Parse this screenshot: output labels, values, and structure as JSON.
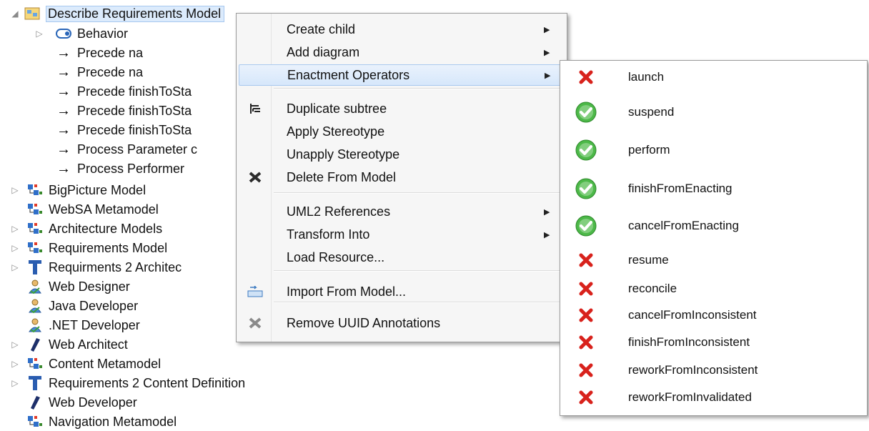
{
  "tree": {
    "root": {
      "label": "Describe Requirements Model"
    },
    "children": [
      {
        "label": "Behavior",
        "icon": "behavior-icon"
      },
      {
        "label": "Precede na",
        "icon": "arrow-icon"
      },
      {
        "label": "Precede na",
        "icon": "arrow-icon"
      },
      {
        "label": "Precede finishToSta",
        "icon": "arrow-icon"
      },
      {
        "label": "Precede finishToSta",
        "icon": "arrow-icon"
      },
      {
        "label": "Precede finishToSta",
        "icon": "arrow-icon"
      },
      {
        "label": "Process Parameter c",
        "icon": "arrow-icon"
      },
      {
        "label": "Process Performer",
        "icon": "arrow-icon"
      }
    ],
    "items": [
      {
        "label": "BigPicture Model",
        "icon": "model-icon",
        "expandable": true
      },
      {
        "label": "WebSA Metamodel",
        "icon": "model-icon",
        "expandable": false
      },
      {
        "label": "Architecture Models",
        "icon": "model-icon",
        "expandable": true
      },
      {
        "label": "Requirements Model",
        "icon": "model-icon",
        "expandable": true
      },
      {
        "label": "Requirments  2 Architec",
        "icon": "transform-icon",
        "expandable": true
      },
      {
        "label": "Web Designer",
        "icon": "role-icon",
        "expandable": false
      },
      {
        "label": "Java Developer",
        "icon": "role-icon",
        "expandable": false
      },
      {
        "label": ".NET  Developer",
        "icon": "role-icon",
        "expandable": false
      },
      {
        "label": "Web Architect",
        "icon": "tool-icon",
        "expandable": true
      },
      {
        "label": "Content Metamodel",
        "icon": "model-icon",
        "expandable": true
      },
      {
        "label": "Requirements 2 Content Definition",
        "icon": "transform-icon",
        "expandable": true
      },
      {
        "label": "Web Developer",
        "icon": "tool-icon",
        "expandable": false
      },
      {
        "label": "Navigation Metamodel",
        "icon": "model-icon",
        "expandable": false
      }
    ]
  },
  "context_menu": {
    "items": [
      {
        "label": "Create child",
        "submenu": true
      },
      {
        "label": "Add diagram",
        "submenu": true
      },
      {
        "label": "Enactment Operators",
        "submenu": true,
        "highlighted": true
      },
      {
        "label": "Duplicate subtree",
        "icon": "duplicate-icon"
      },
      {
        "label": "Apply Stereotype"
      },
      {
        "label": "Unapply Stereotype"
      },
      {
        "label": "Delete From Model",
        "icon": "delete-icon"
      },
      {
        "label": "UML2 References",
        "submenu": true
      },
      {
        "label": "Transform Into",
        "submenu": true
      },
      {
        "label": "Load Resource..."
      },
      {
        "label": "Import From Model...",
        "icon": "import-icon"
      },
      {
        "label": "Remove UUID Annotations",
        "icon": "remove-icon"
      }
    ],
    "submenu_arrow": "▶"
  },
  "enactment_submenu": {
    "items": [
      {
        "label": "launch",
        "status": "disabled"
      },
      {
        "label": "suspend",
        "status": "enabled"
      },
      {
        "label": "perform",
        "status": "enabled"
      },
      {
        "label": "finishFromEnacting",
        "status": "enabled"
      },
      {
        "label": "cancelFromEnacting",
        "status": "enabled"
      },
      {
        "label": "resume",
        "status": "disabled"
      },
      {
        "label": "reconcile",
        "status": "disabled"
      },
      {
        "label": "cancelFromInconsistent",
        "status": "disabled"
      },
      {
        "label": "finishFromInconsistent",
        "status": "disabled"
      },
      {
        "label": "reworkFromInconsistent",
        "status": "disabled"
      },
      {
        "label": "reworkFromInvalidated",
        "status": "disabled"
      }
    ]
  },
  "colors": {
    "selection": "#dcebfc",
    "check_green": "#4cb848",
    "x_red": "#d8221c"
  }
}
